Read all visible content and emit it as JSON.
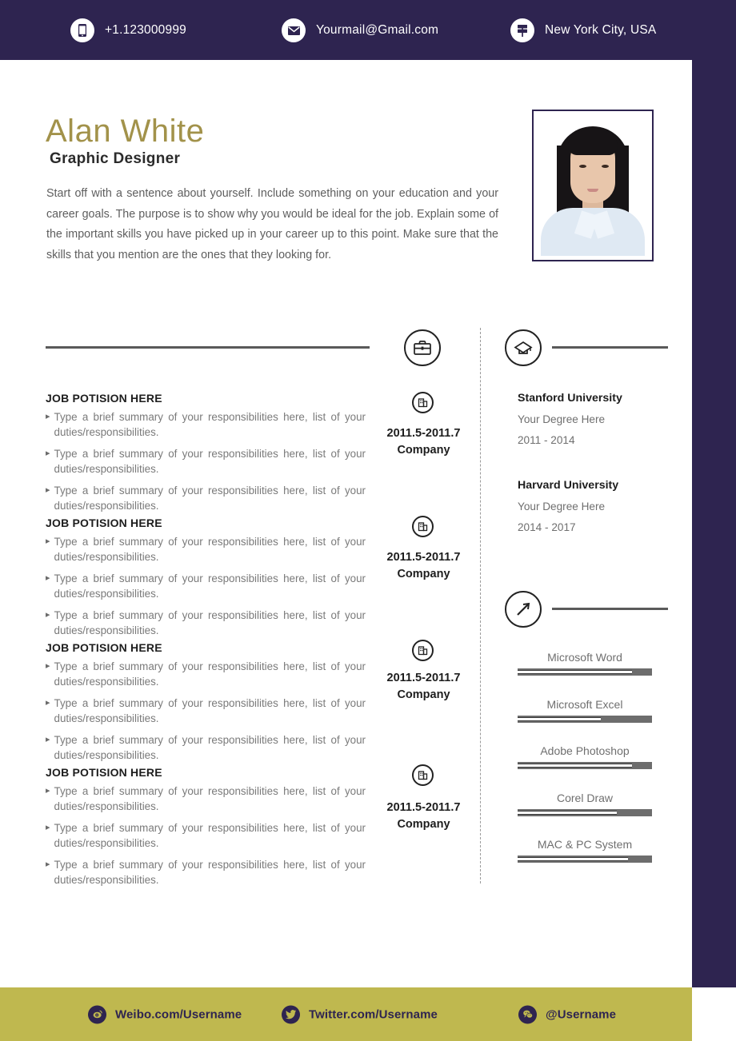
{
  "theme": {
    "navy": "#2e2450",
    "gold": "#a2924a",
    "olive": "#bfb84f",
    "body_text": "#7a7a7a"
  },
  "header": {
    "contacts": [
      {
        "icon": "phone-icon",
        "text": "+1.123000999"
      },
      {
        "icon": "email-icon",
        "text": "Yourmail@Gmail.com"
      },
      {
        "icon": "location-icon",
        "text": "New York City, USA"
      }
    ]
  },
  "identity": {
    "name": "Alan White",
    "title": "Graphic Designer",
    "summary": "Start off with a sentence about yourself. Include something on your education and your career goals. The purpose is to show why you would be ideal for the job. Explain some of the important skills you have picked up in your career up to this point. Make sure that the skills that you mention are the ones that they looking for."
  },
  "experience": {
    "section_icon": "briefcase-icon",
    "jobs": [
      {
        "position": "JOB POTISION HERE",
        "duties": [
          "Type a brief summary of your responsibilities here, list of your duties/responsibilities.",
          "Type a brief summary of your responsibilities here, list of your duties/responsibilities.",
          "Type a brief summary of your responsibilities here, list of your duties/responsibilities."
        ]
      },
      {
        "position": "JOB POTISION HERE",
        "duties": [
          "Type a brief summary of your responsibilities here, list of your duties/responsibilities.",
          "Type a brief summary of your responsibilities here, list of your duties/responsibilities.",
          "Type a brief summary of your responsibilities here, list of your duties/responsibilities."
        ]
      },
      {
        "position": "JOB POTISION HERE",
        "duties": [
          "Type a brief summary of your responsibilities here, list of your duties/responsibilities.",
          "Type a brief summary of your responsibilities here, list of your duties/responsibilities.",
          "Type a brief summary of your responsibilities here, list of your duties/responsibilities."
        ]
      },
      {
        "position": "JOB POTISION HERE",
        "duties": [
          "Type a brief summary of your responsibilities here, list of your duties/responsibilities.",
          "Type a brief summary of your responsibilities here, list of your duties/responsibilities.",
          "Type a brief summary of your responsibilities here, list of your duties/responsibilities."
        ]
      }
    ],
    "timeline": [
      {
        "icon": "building-icon",
        "date": "2011.5-2011.7",
        "company": "Company"
      },
      {
        "icon": "building-icon",
        "date": "2011.5-2011.7",
        "company": "Company"
      },
      {
        "icon": "building-icon",
        "date": "2011.5-2011.7",
        "company": "Company"
      },
      {
        "icon": "building-icon",
        "date": "2011.5-2011.7",
        "company": "Company"
      }
    ]
  },
  "education": {
    "section_icon": "graduation-cap-icon",
    "entries": [
      {
        "school": "Stanford University",
        "degree": "Your Degree Here",
        "years": "2011 - 2014"
      },
      {
        "school": "Harvard University",
        "degree": "Your Degree Here",
        "years": "2014 - 2017"
      }
    ]
  },
  "skills": {
    "section_icon": "hammer-icon",
    "items": [
      {
        "name": "Microsoft Word",
        "percent": 85
      },
      {
        "name": "Microsoft Excel",
        "percent": 62
      },
      {
        "name": "Adobe Photoshop",
        "percent": 85
      },
      {
        "name": "Corel Draw",
        "percent": 74
      },
      {
        "name": "MAC & PC System",
        "percent": 82
      }
    ]
  },
  "footer": {
    "links": [
      {
        "icon": "weibo-icon",
        "text": "Weibo.com/Username"
      },
      {
        "icon": "twitter-icon",
        "text": "Twitter.com/Username"
      },
      {
        "icon": "wechat-icon",
        "text": "@Username"
      }
    ]
  }
}
